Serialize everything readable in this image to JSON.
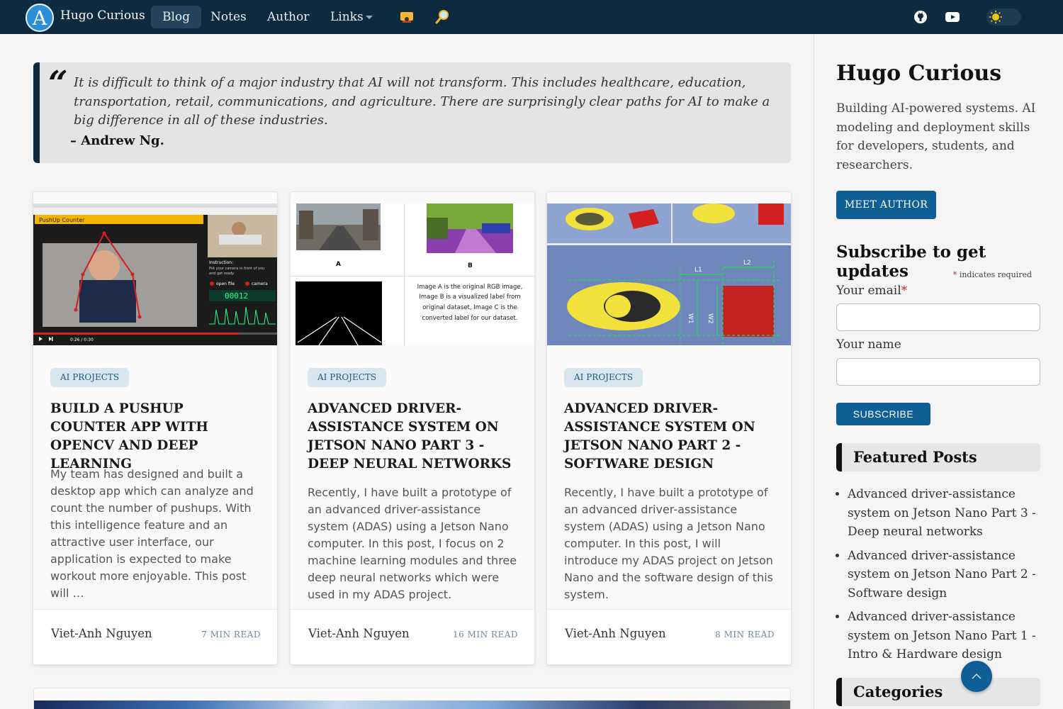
{
  "nav": {
    "logo_letter": "A",
    "brand": "Hugo Curious",
    "items": [
      {
        "label": "Blog",
        "active": true
      },
      {
        "label": "Notes"
      },
      {
        "label": "Author"
      },
      {
        "label": "Links",
        "dropdown": true
      }
    ],
    "icons": [
      "hat-icon",
      "search-icon",
      "github-icon",
      "youtube-icon",
      "sun-icon"
    ]
  },
  "quote": {
    "mark": "“",
    "text": "It is difficult to think of a major industry that AI will not transform. This includes healthcare, education, transportation, retail, communications, and agriculture. There are surprisingly clear paths for AI to make a big difference in all of these industries.",
    "author": "– Andrew Ng."
  },
  "posts": [
    {
      "category": "AI PROJECTS",
      "title": "BUILD A PUSHUP COUNTER APP WITH OPENCV AND DEEP LEARNING",
      "excerpt": "My team has designed and built a desktop app which can analyze and count the number of pushups. With this intelligence feature and an attractive user interface, our application is expected to make workout more enjoyable. This post will …",
      "author": "Viet-Anh Nguyen",
      "read_time": "7 MIN READ",
      "thumb": {
        "app_label": "PushUp Counter",
        "instruction_title": "Instruction:",
        "instruction_text": "Put your camera in front of you and get ready.",
        "open_file": "open file",
        "camera": "camera",
        "counter": "00012",
        "time": "0:26 / 0:30"
      }
    },
    {
      "category": "AI PROJECTS",
      "title": "ADVANCED DRIVER-ASSISTANCE SYSTEM ON JETSON NANO PART 3 - DEEP NEURAL NETWORKS",
      "excerpt": "Recently, I have built a prototype of an advanced driver-assistance system (ADAS) using a Jetson Nano computer. In this post, I focus on 2 machine learning modules and three deep neural networks which were used in my ADAS project.",
      "author": "Viet-Anh Nguyen",
      "read_time": "16 MIN READ",
      "thumb": {
        "label_a": "A",
        "label_b": "B",
        "caption": "Image A is the original RGB image, Image B is a visualized label from original dataset, Image C is the converted label for our dataset."
      }
    },
    {
      "category": "AI PROJECTS",
      "title": "ADVANCED DRIVER-ASSISTANCE SYSTEM ON JETSON NANO PART 2 - SOFTWARE DESIGN",
      "excerpt": "Recently, I have built a prototype of an advanced driver-assistance system (ADAS) using a Jetson Nano computer. In this post, I will introduce my ADAS project on Jetson Nano and the software design of this system.",
      "author": "Viet-Anh Nguyen",
      "read_time": "8 MIN READ",
      "thumb": {
        "l1": "L1",
        "l2": "L2",
        "w1": "W1",
        "w2": "W2"
      }
    }
  ],
  "sidebar": {
    "title": "Hugo Curious",
    "description": "Building AI-powered systems. AI modeling and deployment skills for developers, students, and researchers.",
    "meet_button": "MEET AUTHOR",
    "subscribe": {
      "title": "Subscribe to get updates",
      "required_star": "*",
      "required_note": " indicates required",
      "email_label": "Your email",
      "email_star": "*",
      "email_value": "",
      "name_label": "Your name",
      "name_value": "",
      "button": "SUBSCRIBE"
    },
    "featured_title": "Featured Posts",
    "featured": [
      "Advanced driver-assistance system on Jetson Nano Part 3 - Deep neural networks",
      "Advanced driver-assistance system on Jetson Nano Part 2 - Software design",
      "Advanced driver-assistance system on Jetson Nano Part 1 - Intro & Hardware design"
    ],
    "categories_title": "Categories"
  },
  "colors": {
    "navbar": "#0e2a3f",
    "accent": "#0f5e96",
    "badge_bg": "#d8e6ef",
    "required": "#c02b2b"
  }
}
